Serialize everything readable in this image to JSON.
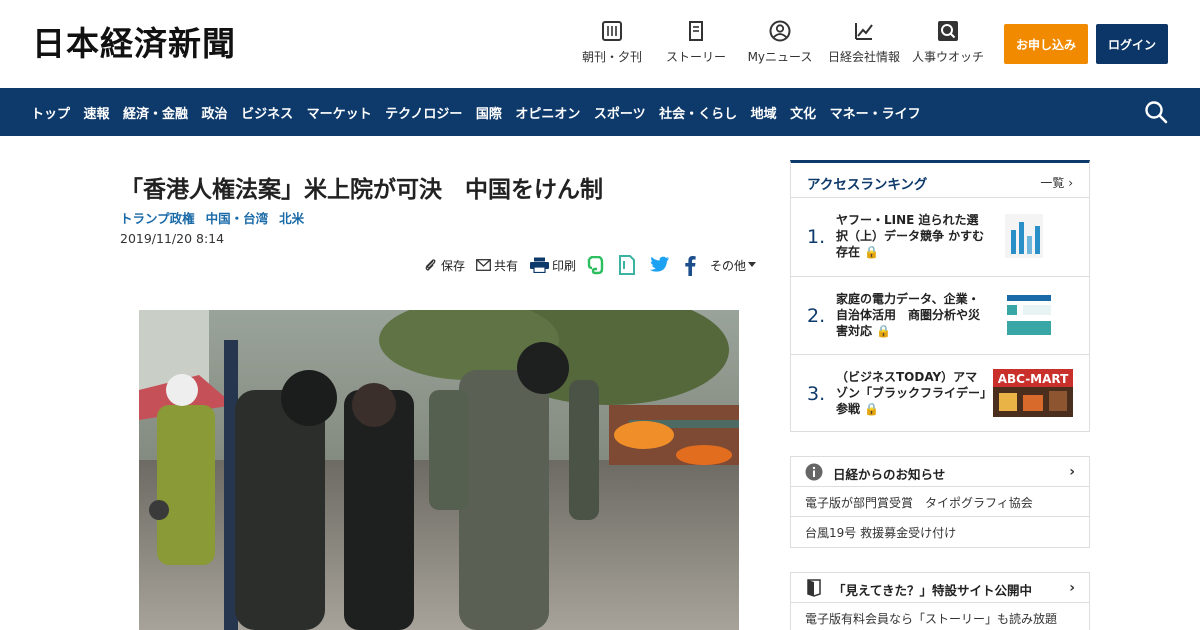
{
  "header": {
    "logo": "日本経済新聞",
    "nav": [
      {
        "label": "朝刊・夕刊",
        "icon": "newspaper-icon"
      },
      {
        "label": "ストーリー",
        "icon": "book-icon"
      },
      {
        "label": "Myニュース",
        "icon": "person-icon"
      },
      {
        "label": "日経会社情報",
        "icon": "company-chart-icon"
      },
      {
        "label": "人事ウオッチ",
        "icon": "person-search-icon"
      }
    ],
    "apply_label": "お申し込み",
    "login_label": "ログイン"
  },
  "main_nav": [
    "トップ",
    "速報",
    "経済・金融",
    "政治",
    "ビジネス",
    "マーケット",
    "テクノロジー",
    "国際",
    "オピニオン",
    "スポーツ",
    "社会・くらし",
    "地域",
    "文化",
    "マネー・ライフ"
  ],
  "article": {
    "title": "「香港人権法案」米上院が可決　中国をけん制",
    "tags": [
      "トランプ政権",
      "中国・台湾",
      "北米"
    ],
    "date": "2019/11/20 8:14",
    "share": {
      "save": "保存",
      "share": "共有",
      "print": "印刷",
      "more": "その他"
    }
  },
  "ranking": {
    "title": "アクセスランキング",
    "more": "一覧",
    "items": [
      {
        "rank": "1.",
        "text": "ヤフー・LINE 迫られた選択（上）データ競争 かすむ存在"
      },
      {
        "rank": "2.",
        "text": "家庭の電力データ、企業・自治体活用　商圏分析や災害対応"
      },
      {
        "rank": "3.",
        "text": "（ビジネスTODAY）アマゾン「ブラックフライデー」参戦"
      }
    ],
    "thumb3_text": "ABC-MART"
  },
  "notices": {
    "title": "日経からのお知らせ",
    "items": [
      "電子版が部門賞受賞　タイポグラフィ協会",
      "台風19号 救援募金受け付け"
    ]
  },
  "promo": {
    "title": "「見えてきた？」特設サイト公開中",
    "items": [
      "電子版有料会員なら「ストーリー」も読み放題"
    ]
  },
  "colors": {
    "brand_navy": "#0e3a6b",
    "apply_orange": "#f28a00",
    "tag_blue": "#1a6aa8"
  }
}
